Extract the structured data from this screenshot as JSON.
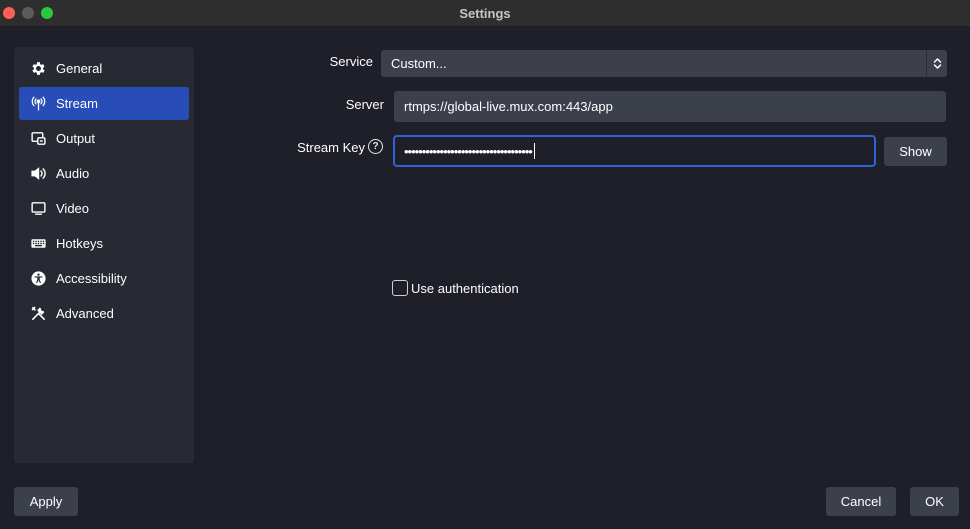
{
  "window": {
    "title": "Settings"
  },
  "sidebar": {
    "items": [
      {
        "label": "General",
        "icon": "gear-icon"
      },
      {
        "label": "Stream",
        "icon": "antenna-icon",
        "active": true
      },
      {
        "label": "Output",
        "icon": "output-icon"
      },
      {
        "label": "Audio",
        "icon": "speaker-icon"
      },
      {
        "label": "Video",
        "icon": "monitor-icon"
      },
      {
        "label": "Hotkeys",
        "icon": "keyboard-icon"
      },
      {
        "label": "Accessibility",
        "icon": "accessibility-icon"
      },
      {
        "label": "Advanced",
        "icon": "tools-icon"
      }
    ]
  },
  "stream": {
    "service_label": "Service",
    "service_value": "Custom...",
    "server_label": "Server",
    "server_value": "rtmps://global-live.mux.com:443/app",
    "stream_key_label": "Stream Key",
    "stream_key_value": "••••••••••••••••••••••••••••••••••••",
    "show_label": "Show",
    "help_glyph": "?",
    "use_auth_label": "Use authentication",
    "use_auth_checked": false
  },
  "footer": {
    "apply_label": "Apply",
    "cancel_label": "Cancel",
    "ok_label": "OK"
  },
  "colors": {
    "accent": "#284cb8",
    "focus": "#2f63d6",
    "background": "#1e1f29",
    "panel": "#272a33",
    "control": "#3c404b"
  }
}
